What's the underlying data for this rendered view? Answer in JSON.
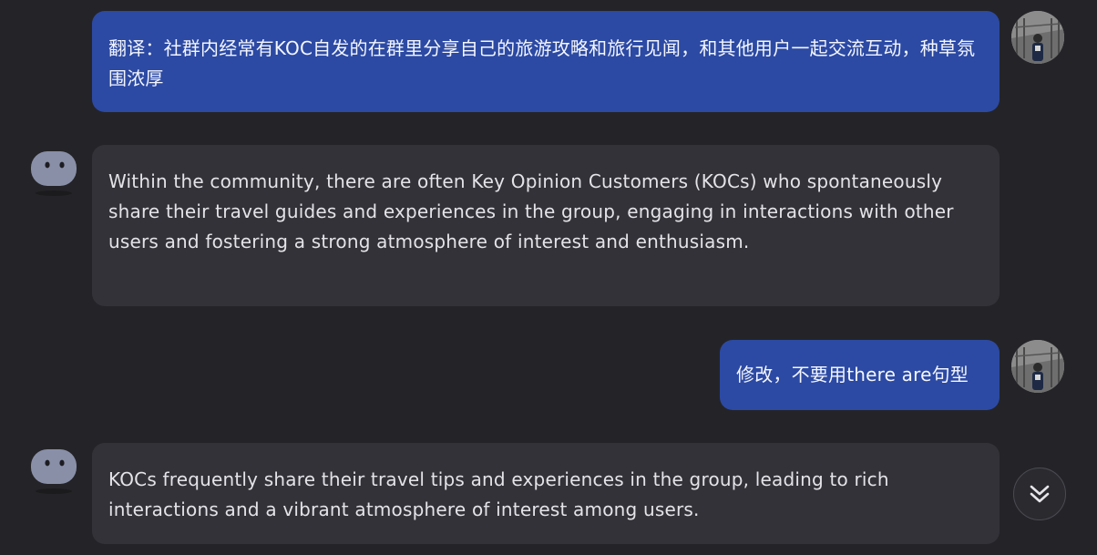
{
  "messages": [
    {
      "role": "user",
      "text": "翻译：社群内经常有KOC自发的在群里分享自己的旅游攻略和旅行见闻，和其他用户一起交流互动，种草氛围浓厚"
    },
    {
      "role": "assistant",
      "text": "Within the community, there are often Key Opinion Customers (KOCs) who spontaneously share their travel guides and experiences in the group, engaging in interactions with other users and fostering a strong atmosphere of interest and enthusiasm."
    },
    {
      "role": "user",
      "text": "修改，不要用there are句型"
    },
    {
      "role": "assistant",
      "text": "KOCs frequently share their travel tips and experiences in the group, leading to rich interactions and a vibrant atmosphere of interest among users."
    }
  ],
  "icons": {
    "bot_avatar": "bot-avatar-icon",
    "user_avatar": "user-photo-avatar",
    "scroll_down": "double-chevron-down-icon"
  },
  "colors": {
    "background": "#242428",
    "user_bubble": "#2c4aa3",
    "assistant_bubble": "#323238",
    "bot_avatar": "#8a8fa8"
  }
}
